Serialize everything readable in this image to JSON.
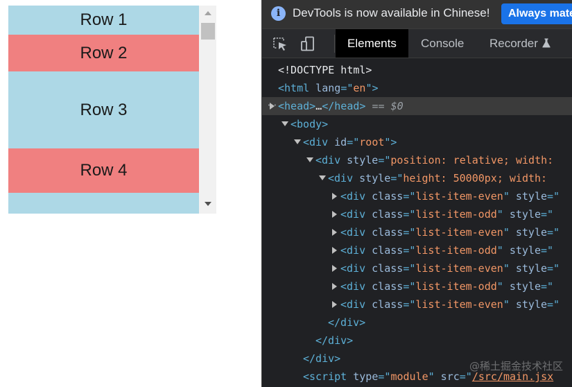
{
  "list": {
    "rows": [
      {
        "label": "Row 1",
        "tone": "even"
      },
      {
        "label": "Row 2",
        "tone": "odd"
      },
      {
        "label": "Row 3",
        "tone": "even"
      },
      {
        "label": "Row 4",
        "tone": "odd"
      },
      {
        "label": "",
        "tone": "even"
      }
    ],
    "colors": {
      "even": "#add8e6",
      "odd": "#f08080",
      "scroll_track": "#f1f1f1"
    }
  },
  "devtools": {
    "infobar": {
      "message": "DevTools is now available in Chinese!",
      "button_label": "Always mate"
    },
    "tabs": [
      {
        "label": "Elements",
        "active": true
      },
      {
        "label": "Console",
        "active": false
      },
      {
        "label": "Recorder",
        "active": false
      }
    ],
    "dom_lines": [
      {
        "indent": 0,
        "toggle": "none",
        "selected": false,
        "parts": [
          {
            "t": "doc",
            "s": "<!DOCTYPE html>"
          }
        ]
      },
      {
        "indent": 0,
        "toggle": "none",
        "selected": false,
        "parts": [
          {
            "t": "tag",
            "s": "<html"
          },
          {
            "t": "attr",
            "s": " lang"
          },
          {
            "t": "tag",
            "s": "=\""
          },
          {
            "t": "val",
            "s": "en"
          },
          {
            "t": "tag",
            "s": "\">"
          }
        ]
      },
      {
        "indent": 0,
        "toggle": "closed",
        "selected": true,
        "gutter": "···",
        "parts": [
          {
            "t": "tag",
            "s": "<head>"
          },
          {
            "t": "doc",
            "s": "…"
          },
          {
            "t": "tag",
            "s": "</head>"
          },
          {
            "t": "eq",
            "s": " == "
          },
          {
            "t": "ref",
            "s": "$0"
          }
        ]
      },
      {
        "indent": 1,
        "toggle": "open",
        "selected": false,
        "parts": [
          {
            "t": "tag",
            "s": "<body>"
          }
        ]
      },
      {
        "indent": 2,
        "toggle": "open",
        "selected": false,
        "parts": [
          {
            "t": "tag",
            "s": "<div"
          },
          {
            "t": "attr",
            "s": " id"
          },
          {
            "t": "tag",
            "s": "=\""
          },
          {
            "t": "val",
            "s": "root"
          },
          {
            "t": "tag",
            "s": "\">"
          }
        ]
      },
      {
        "indent": 3,
        "toggle": "open",
        "selected": false,
        "parts": [
          {
            "t": "tag",
            "s": "<div"
          },
          {
            "t": "attr",
            "s": " style"
          },
          {
            "t": "tag",
            "s": "=\""
          },
          {
            "t": "val",
            "s": "position: relative; width:"
          }
        ]
      },
      {
        "indent": 4,
        "toggle": "open",
        "selected": false,
        "parts": [
          {
            "t": "tag",
            "s": "<div"
          },
          {
            "t": "attr",
            "s": " style"
          },
          {
            "t": "tag",
            "s": "=\""
          },
          {
            "t": "val",
            "s": "height: 50000px; width: "
          }
        ]
      },
      {
        "indent": 5,
        "toggle": "closed",
        "selected": false,
        "parts": [
          {
            "t": "tag",
            "s": "<div"
          },
          {
            "t": "attr",
            "s": " class"
          },
          {
            "t": "tag",
            "s": "=\""
          },
          {
            "t": "val",
            "s": "list-item-even"
          },
          {
            "t": "tag",
            "s": "\""
          },
          {
            "t": "attr",
            "s": " style"
          },
          {
            "t": "tag",
            "s": "=\""
          }
        ]
      },
      {
        "indent": 5,
        "toggle": "closed",
        "selected": false,
        "parts": [
          {
            "t": "tag",
            "s": "<div"
          },
          {
            "t": "attr",
            "s": " class"
          },
          {
            "t": "tag",
            "s": "=\""
          },
          {
            "t": "val",
            "s": "list-item-odd"
          },
          {
            "t": "tag",
            "s": "\""
          },
          {
            "t": "attr",
            "s": " style"
          },
          {
            "t": "tag",
            "s": "=\""
          }
        ]
      },
      {
        "indent": 5,
        "toggle": "closed",
        "selected": false,
        "parts": [
          {
            "t": "tag",
            "s": "<div"
          },
          {
            "t": "attr",
            "s": " class"
          },
          {
            "t": "tag",
            "s": "=\""
          },
          {
            "t": "val",
            "s": "list-item-even"
          },
          {
            "t": "tag",
            "s": "\""
          },
          {
            "t": "attr",
            "s": " style"
          },
          {
            "t": "tag",
            "s": "=\""
          }
        ]
      },
      {
        "indent": 5,
        "toggle": "closed",
        "selected": false,
        "parts": [
          {
            "t": "tag",
            "s": "<div"
          },
          {
            "t": "attr",
            "s": " class"
          },
          {
            "t": "tag",
            "s": "=\""
          },
          {
            "t": "val",
            "s": "list-item-odd"
          },
          {
            "t": "tag",
            "s": "\""
          },
          {
            "t": "attr",
            "s": " style"
          },
          {
            "t": "tag",
            "s": "=\""
          }
        ]
      },
      {
        "indent": 5,
        "toggle": "closed",
        "selected": false,
        "parts": [
          {
            "t": "tag",
            "s": "<div"
          },
          {
            "t": "attr",
            "s": " class"
          },
          {
            "t": "tag",
            "s": "=\""
          },
          {
            "t": "val",
            "s": "list-item-even"
          },
          {
            "t": "tag",
            "s": "\""
          },
          {
            "t": "attr",
            "s": " style"
          },
          {
            "t": "tag",
            "s": "=\""
          }
        ]
      },
      {
        "indent": 5,
        "toggle": "closed",
        "selected": false,
        "parts": [
          {
            "t": "tag",
            "s": "<div"
          },
          {
            "t": "attr",
            "s": " class"
          },
          {
            "t": "tag",
            "s": "=\""
          },
          {
            "t": "val",
            "s": "list-item-odd"
          },
          {
            "t": "tag",
            "s": "\""
          },
          {
            "t": "attr",
            "s": " style"
          },
          {
            "t": "tag",
            "s": "=\""
          }
        ]
      },
      {
        "indent": 5,
        "toggle": "closed",
        "selected": false,
        "parts": [
          {
            "t": "tag",
            "s": "<div"
          },
          {
            "t": "attr",
            "s": " class"
          },
          {
            "t": "tag",
            "s": "=\""
          },
          {
            "t": "val",
            "s": "list-item-even"
          },
          {
            "t": "tag",
            "s": "\""
          },
          {
            "t": "attr",
            "s": " style"
          },
          {
            "t": "tag",
            "s": "=\""
          }
        ]
      },
      {
        "indent": 4,
        "toggle": "none",
        "selected": false,
        "parts": [
          {
            "t": "tag",
            "s": "</div>"
          }
        ]
      },
      {
        "indent": 3,
        "toggle": "none",
        "selected": false,
        "parts": [
          {
            "t": "tag",
            "s": "</div>"
          }
        ]
      },
      {
        "indent": 2,
        "toggle": "none",
        "selected": false,
        "parts": [
          {
            "t": "tag",
            "s": "</div>"
          }
        ]
      },
      {
        "indent": 2,
        "toggle": "none",
        "selected": false,
        "parts": [
          {
            "t": "tag",
            "s": "<script"
          },
          {
            "t": "attr",
            "s": " type"
          },
          {
            "t": "tag",
            "s": "=\""
          },
          {
            "t": "val",
            "s": "module"
          },
          {
            "t": "tag",
            "s": "\""
          },
          {
            "t": "attr",
            "s": " src"
          },
          {
            "t": "tag",
            "s": "=\""
          },
          {
            "t": "link",
            "s": "/src/main.jsx"
          }
        ]
      }
    ],
    "colors": {
      "panel_bg": "#202124",
      "tag": "#5db0d7",
      "attribute": "#9bbbdc",
      "value": "#f29766",
      "button_blue": "#1a73e8"
    }
  },
  "watermark": "@稀土掘金技术社区"
}
